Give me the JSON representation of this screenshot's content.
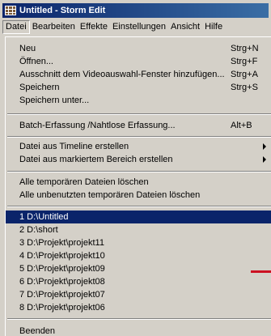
{
  "window": {
    "title": "Untitled - Storm Edit"
  },
  "menubar": [
    "Datei",
    "Bearbeiten",
    "Effekte",
    "Einstellungen",
    "Ansicht",
    "Hilfe"
  ],
  "menu": {
    "items": [
      {
        "label": "Neu",
        "shortcut": "Strg+N"
      },
      {
        "label": "Öffnen...",
        "shortcut": "Strg+F"
      },
      {
        "label": "Ausschnitt dem Videoauswahl-Fenster hinzufügen...",
        "shortcut": "Strg+A"
      },
      {
        "label": "Speichern",
        "shortcut": "Strg+S"
      },
      {
        "label": "Speichern unter...",
        "shortcut": ""
      },
      {
        "label": "Batch-Erfassung /Nahtlose Erfassung...",
        "shortcut": "Alt+B"
      },
      {
        "label": "Datei aus Timeline erstellen",
        "shortcut": ""
      },
      {
        "label": "Datei aus markiertem Bereich erstellen",
        "shortcut": ""
      },
      {
        "label": "Alle temporären Dateien löschen",
        "shortcut": ""
      },
      {
        "label": "Alle unbenutzten temporären Dateien löschen",
        "shortcut": ""
      },
      {
        "label": "1 D:\\Untitled",
        "shortcut": ""
      },
      {
        "label": "2 D:\\short",
        "shortcut": ""
      },
      {
        "label": "3 D:\\Projekt\\projekt11",
        "shortcut": ""
      },
      {
        "label": "4 D:\\Projekt\\projekt10",
        "shortcut": ""
      },
      {
        "label": "5 D:\\Projekt\\projekt09",
        "shortcut": ""
      },
      {
        "label": "6 D:\\Projekt\\projekt08",
        "shortcut": ""
      },
      {
        "label": "7 D:\\Projekt\\projekt07",
        "shortcut": ""
      },
      {
        "label": "8 D:\\Projekt\\projekt06",
        "shortcut": ""
      },
      {
        "label": "Beenden",
        "shortcut": ""
      }
    ]
  },
  "colors": {
    "selection": "#0a246a",
    "face": "#d4d0c8",
    "annotation_mark": "#cc1122"
  }
}
